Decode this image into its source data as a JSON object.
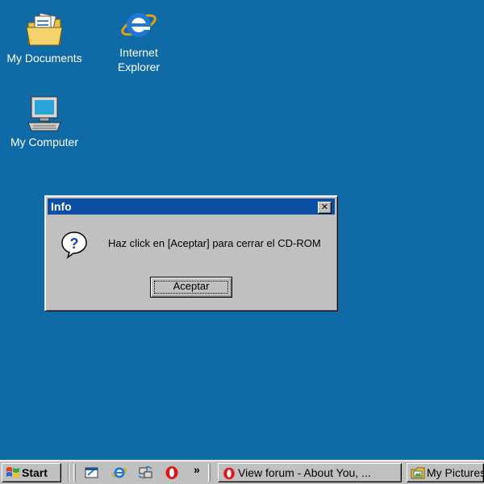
{
  "desktop": {
    "icons": [
      {
        "label": "My Documents",
        "icon": "folder-documents-icon"
      },
      {
        "label": "Internet Explorer",
        "icon": "internet-explorer-icon"
      },
      {
        "label": "My Computer",
        "icon": "computer-icon"
      }
    ],
    "background_color": "#0f6aa6"
  },
  "dialog": {
    "title": "Info",
    "close_label": "✕",
    "icon": "question-icon",
    "message": "Haz click en [Aceptar] para cerrar el CD-ROM",
    "ok_label": "Aceptar"
  },
  "taskbar": {
    "start_label": "Start",
    "quicklaunch": [
      {
        "icon": "show-desktop-icon"
      },
      {
        "icon": "internet-explorer-icon"
      },
      {
        "icon": "network-sync-icon"
      },
      {
        "icon": "opera-icon"
      }
    ],
    "overflow_label": "»",
    "tasks": [
      {
        "label": "View forum - About You, ...",
        "icon": "opera-icon"
      },
      {
        "label": "My Pictures",
        "icon": "folder-pictures-icon"
      }
    ]
  }
}
